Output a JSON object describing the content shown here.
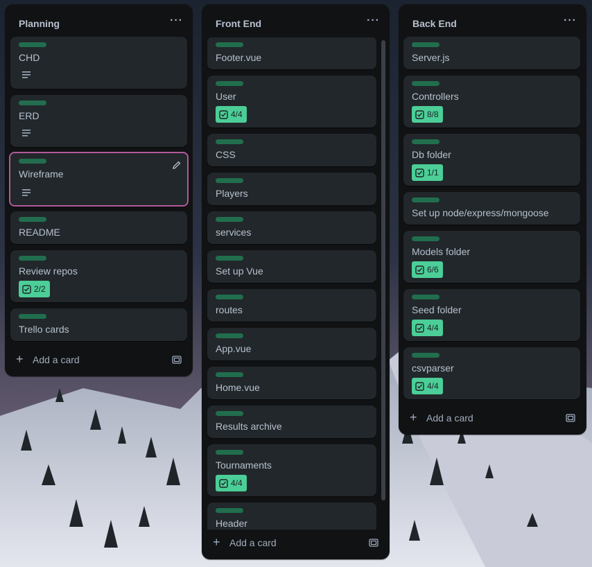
{
  "colors": {
    "list_bg": "#111214",
    "card_bg": "#22272b",
    "label_green": "#216e4e",
    "badge_green": "#4bce97",
    "selected_border": "#b35a99",
    "text": "#b6c2cf"
  },
  "board": {
    "lists": [
      {
        "title": "Planning",
        "menu_label": "···",
        "add_card_label": "Add a card",
        "cards": [
          {
            "title": "CHD",
            "has_description": true
          },
          {
            "title": "ERD",
            "has_description": true
          },
          {
            "title": "Wireframe",
            "has_description": true,
            "selected": true
          },
          {
            "title": "README"
          },
          {
            "title": "Review repos",
            "checklist": "2/2"
          },
          {
            "title": "Trello cards"
          }
        ]
      },
      {
        "title": "Front End",
        "menu_label": "···",
        "add_card_label": "Add a card",
        "cards": [
          {
            "title": "Footer.vue"
          },
          {
            "title": "User",
            "checklist": "4/4"
          },
          {
            "title": "CSS"
          },
          {
            "title": "Players"
          },
          {
            "title": "services"
          },
          {
            "title": "Set up Vue"
          },
          {
            "title": "routes"
          },
          {
            "title": "App.vue"
          },
          {
            "title": "Home.vue"
          },
          {
            "title": "Results archive"
          },
          {
            "title": "Tournaments",
            "checklist": "4/4"
          },
          {
            "title": "Header"
          }
        ]
      },
      {
        "title": "Back End",
        "menu_label": "···",
        "add_card_label": "Add a card",
        "cards": [
          {
            "title": "Server.js"
          },
          {
            "title": "Controllers",
            "checklist": "8/8"
          },
          {
            "title": "Db folder",
            "checklist": "1/1"
          },
          {
            "title": "Set up node/express/mongoose"
          },
          {
            "title": "Models folder",
            "checklist": "6/6"
          },
          {
            "title": "Seed folder",
            "checklist": "4/4"
          },
          {
            "title": "csvparser",
            "checklist": "4/4"
          }
        ]
      }
    ]
  }
}
